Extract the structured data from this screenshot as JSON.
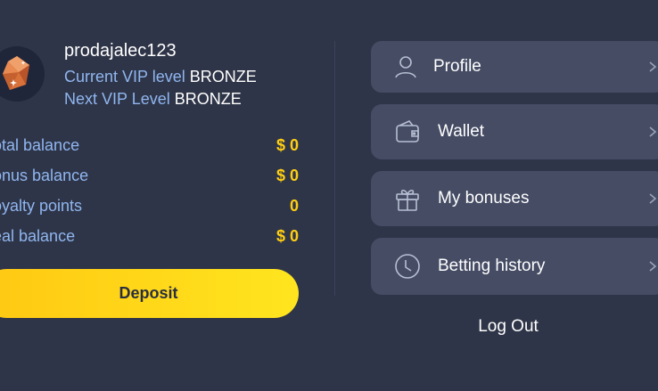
{
  "user": {
    "username": "prodajalec123",
    "current_vip_label": "Current VIP level",
    "current_vip_value": "BRONZE",
    "next_vip_label": "Next VIP Level",
    "next_vip_value": "BRONZE"
  },
  "balances": [
    {
      "label": "otal balance",
      "value": "$ 0"
    },
    {
      "label": "onus balance",
      "value": "$ 0"
    },
    {
      "label": "oyalty points",
      "value": "0"
    },
    {
      "label": "eal balance",
      "value": "$ 0"
    }
  ],
  "deposit_label": "Deposit",
  "menu": [
    {
      "label": "Profile",
      "icon": "user-icon"
    },
    {
      "label": "Wallet",
      "icon": "wallet-icon"
    },
    {
      "label": "My bonuses",
      "icon": "gift-icon"
    },
    {
      "label": "Betting history",
      "icon": "clock-icon"
    }
  ],
  "logout_label": "Log Out",
  "colors": {
    "background": "#2f3548",
    "card": "#454c64",
    "accent_yellow": "#ffcf12",
    "label_blue": "#8fb6f0"
  }
}
